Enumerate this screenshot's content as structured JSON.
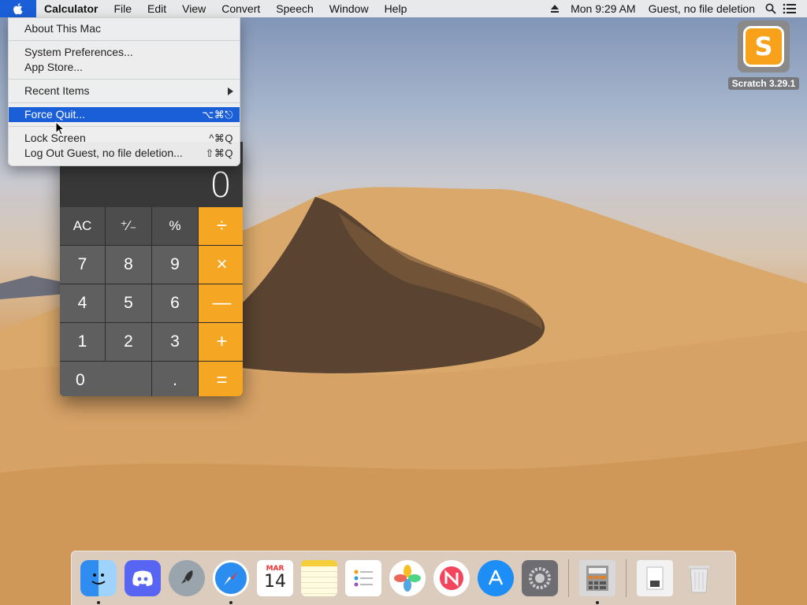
{
  "menubar": {
    "apple_icon": "apple-logo-icon",
    "app_name": "Calculator",
    "items": [
      "File",
      "Edit",
      "View",
      "Convert",
      "Speech",
      "Window",
      "Help"
    ],
    "eject_icon": "eject-icon",
    "clock": "Mon 9:29 AM",
    "user": "Guest, no file deletion",
    "search_icon": "spotlight-search-icon",
    "notifications_icon": "notification-center-icon"
  },
  "apple_menu": {
    "about": "About This Mac",
    "system_prefs": "System Preferences...",
    "app_store": "App Store...",
    "recent_items": "Recent Items",
    "force_quit": "Force Quit...",
    "force_quit_shortcut": "⌥⌘⎋",
    "lock_screen": "Lock Screen",
    "lock_screen_shortcut": "^⌘Q",
    "log_out": "Log Out Guest, no file deletion...",
    "log_out_shortcut": "⇧⌘Q"
  },
  "calculator": {
    "display": "0",
    "keys": {
      "ac": "AC",
      "plus_minus": "⁺∕₋",
      "percent": "%",
      "divide": "÷",
      "seven": "7",
      "eight": "8",
      "nine": "9",
      "multiply": "×",
      "four": "4",
      "five": "5",
      "six": "6",
      "minus": "—",
      "one": "1",
      "two": "2",
      "three": "3",
      "plus": "+",
      "zero": "0",
      "decimal": ".",
      "equals": "="
    },
    "operator_color": "#f5a623"
  },
  "desktop": {
    "scratch_label": "Scratch 3.29.1",
    "scratch_logo_letter": "S"
  },
  "dock": {
    "calendar_month": "MAR",
    "calendar_day": "14",
    "items": [
      "finder-icon",
      "discord-icon",
      "launchpad-icon",
      "safari-icon",
      "calendar-icon",
      "notes-icon",
      "reminders-icon",
      "photos-icon",
      "news-icon",
      "app-store-icon",
      "system-preferences-icon",
      "calculator-icon",
      "downloads-icon",
      "trash-icon"
    ]
  }
}
